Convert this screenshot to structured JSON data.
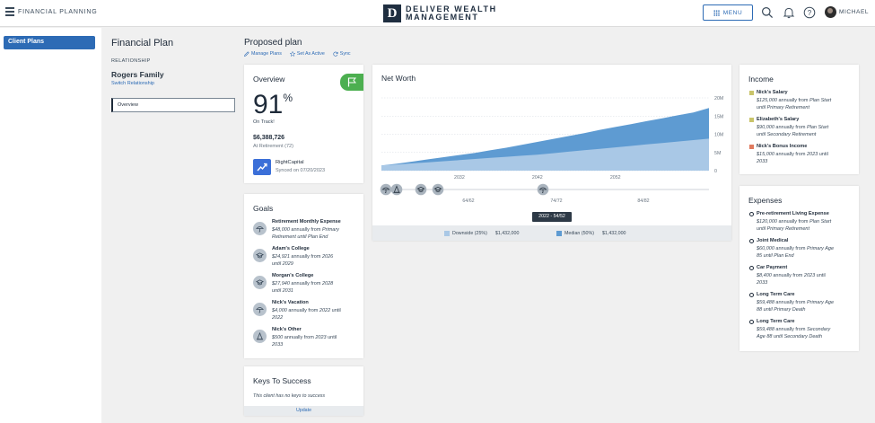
{
  "header": {
    "app_title": "FINANCIAL PLANNING",
    "brand_letter": "D",
    "brand_line1": "DELIVER WEALTH",
    "brand_line2": "MANAGEMENT",
    "menu_label": "MENU",
    "user_name": "MICHAEL",
    "icons": [
      "hamburger-icon",
      "search-icon",
      "bell-icon",
      "help-icon"
    ]
  },
  "sidebar": {
    "items": [
      {
        "label": "Client Plans"
      }
    ]
  },
  "plan": {
    "title": "Financial Plan",
    "relationship_label": "RELATIONSHIP",
    "family": "Rogers Family",
    "switch_label": "Switch Relationship",
    "nav_selected": "Overview"
  },
  "proposed": {
    "title": "Proposed plan",
    "actions": [
      {
        "label": "Manage Plans",
        "icon": "edit-icon"
      },
      {
        "label": "Set As Active",
        "icon": "star-icon"
      },
      {
        "label": "Sync",
        "icon": "sync-icon"
      }
    ]
  },
  "overview": {
    "title": "Overview",
    "percent": "91",
    "percent_sign": "%",
    "status": "On Track!",
    "retire_value": "$6,388,726",
    "retire_label": "At Retirement (72)",
    "provider": "RightCapital",
    "synced": "Synced on 07/20/2023",
    "flag_color": "#4caf50"
  },
  "goals": {
    "title": "Goals",
    "items": [
      {
        "name": "Retirement Monthly Expense",
        "line1_amt": "$48,000",
        "line1_rest": " annually from ",
        "line1_from": "Primary",
        "line2": "Retirement until Plan End",
        "icon": "umbrella-icon"
      },
      {
        "name": "Adam's College",
        "line1_amt": "$24,921",
        "line1_rest": " annually from ",
        "line1_from": "2026",
        "line2": "until 2029",
        "icon": "graduation-cap-icon"
      },
      {
        "name": "Morgan's College",
        "line1_amt": "$27,940",
        "line1_rest": " annually from ",
        "line1_from": "2028",
        "line2": "until 2031",
        "icon": "graduation-cap-icon"
      },
      {
        "name": "Nick's Vacation",
        "line1_amt": "$4,000",
        "line1_rest": " annually from ",
        "line1_from": "2022",
        "line1_tail": " until",
        "line2": "2022",
        "icon": "umbrella-icon"
      },
      {
        "name": "Nick's Other",
        "line1_amt": "$500",
        "line1_rest": " annually from ",
        "line1_from": "2023",
        "line1_tail": " until",
        "line2": "2033",
        "icon": "traffic-cone-icon"
      }
    ]
  },
  "keys": {
    "title": "Keys To Success",
    "empty_text": "This client has no keys to success",
    "update_label": "Update"
  },
  "net_worth": {
    "title": "Net Worth",
    "tooltip": "2022 - 54/52",
    "legend": [
      {
        "label": "Downside (25%)",
        "value": "$1,432,000",
        "color": "#a9c8e6"
      },
      {
        "label": "Median (50%)",
        "value": "$1,432,000",
        "color": "#5e9bd2"
      }
    ],
    "age_labels": [
      "64/62",
      "74/72",
      "84/82"
    ],
    "timeline_icons": [
      "umbrella-icon",
      "traffic-cone-icon",
      "graduation-cap-icon",
      "graduation-cap-icon",
      "umbrella-icon"
    ]
  },
  "chart_data": {
    "type": "area",
    "title": "Net Worth",
    "x": [
      2022,
      2024,
      2026,
      2028,
      2030,
      2032,
      2034,
      2036,
      2038,
      2040,
      2042,
      2044,
      2046,
      2048,
      2050,
      2052,
      2054,
      2056,
      2058,
      2060,
      2062,
      2064
    ],
    "x_ticks": [
      "2032",
      "2042",
      "2052"
    ],
    "y_ticks": [
      "20M",
      "15M",
      "10M",
      "5M",
      "0"
    ],
    "ylim": [
      0,
      20
    ],
    "series": [
      {
        "name": "Median (50%)",
        "values": [
          1.4,
          1.9,
          2.5,
          3.1,
          3.7,
          4.3,
          4.9,
          5.6,
          6.3,
          7.1,
          7.9,
          8.7,
          9.5,
          10.3,
          11.2,
          12.0,
          12.8,
          13.6,
          14.4,
          15.2,
          16.0,
          17.2
        ]
      },
      {
        "name": "Downside (25%)",
        "values": [
          1.4,
          1.7,
          2.0,
          2.3,
          2.6,
          2.9,
          3.2,
          3.5,
          3.8,
          4.1,
          4.4,
          4.8,
          5.2,
          5.6,
          6.0,
          6.4,
          6.8,
          7.2,
          7.6,
          8.0,
          8.4,
          8.8
        ]
      }
    ],
    "grid": true,
    "legend_position": "bottom"
  },
  "income": {
    "title": "Income",
    "items": [
      {
        "name": "Nick's Salary",
        "amt": "$125,000",
        "rest": " annually from ",
        "from": "Plan Start",
        "line2": "until Primary Retirement",
        "color": "#c9c46a"
      },
      {
        "name": "Elizabeth's Salary",
        "amt": "$90,000",
        "rest": " annually from ",
        "from": "Plan Start",
        "line2": "until Secondary Retirement",
        "color": "#c9c46a"
      },
      {
        "name": "Nick's Bonus Income",
        "amt": "$15,000",
        "rest": " annually from ",
        "from": "2023",
        "tail": " until",
        "line2": "2033",
        "color": "#e07a5f"
      }
    ]
  },
  "expenses": {
    "title": "Expenses",
    "items": [
      {
        "name": "Pre-retirement Living Expense",
        "amt": "$120,000",
        "rest": " annually from ",
        "from": "Plan Start",
        "line2": "until Primary Retirement"
      },
      {
        "name": "Joint Medical",
        "amt": "$60,000",
        "rest": " annually from ",
        "from": "Primary Age",
        "line2": "85 until Plan End"
      },
      {
        "name": "Car Payment",
        "amt": "$8,400",
        "rest": " annually from ",
        "from": "2023",
        "tail": " until",
        "line2": "2033"
      },
      {
        "name": "Long Term Care",
        "amt": "$59,488",
        "rest": " annually from ",
        "from": "Primary Age",
        "line2": "88 until Primary Death"
      },
      {
        "name": "Long Term Care",
        "amt": "$59,488",
        "rest": " annually from ",
        "from": "Secondary",
        "line2": "Age 88 until Secondary Death"
      }
    ]
  }
}
